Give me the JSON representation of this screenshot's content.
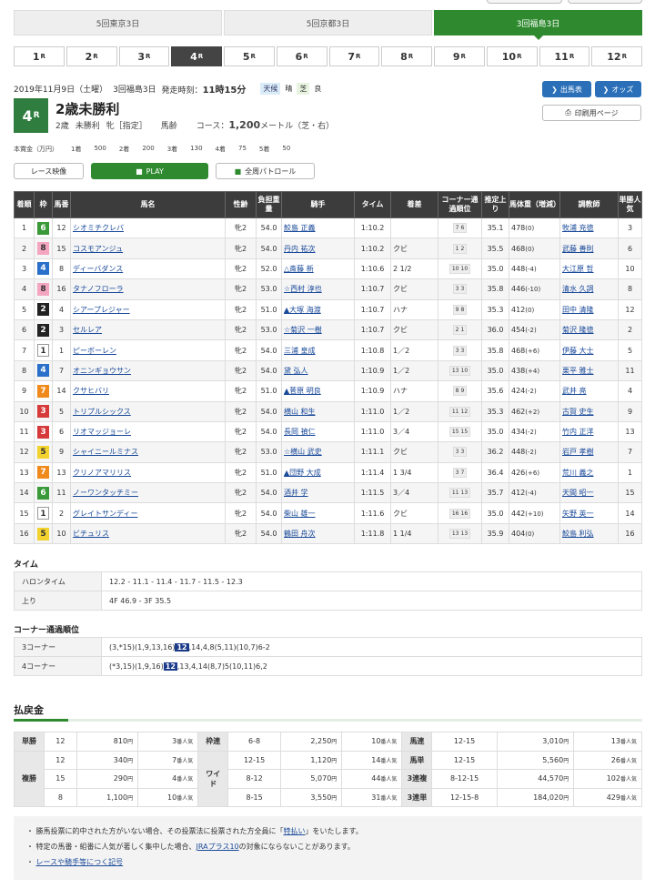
{
  "venues": [
    "5回東京3日",
    "5回京都3日",
    "3回福島3日"
  ],
  "race_numbers": [
    "1",
    "2",
    "3",
    "4",
    "5",
    "6",
    "7",
    "8",
    "9",
    "10",
    "11",
    "12"
  ],
  "race_suffix": "R",
  "header": {
    "date": "2019年11月9日（土曜）",
    "meeting": "3回福島3日",
    "start_label": "発走時刻：",
    "start_time": "11時15分",
    "weather_label": "天候",
    "weather": "晴",
    "track_label": "芝",
    "track": "良"
  },
  "race": {
    "num": "4",
    "name": "2歳未勝利",
    "age": "2歳",
    "cls": "未勝利",
    "sex": "牝［指定］",
    "weight_type": "馬齢",
    "course_label": "コース：",
    "distance": "1,200",
    "course_unit": "メートル（芝・右）"
  },
  "buttons": {
    "entries": "出馬表",
    "odds": "オッズ",
    "print": "印刷用ページ",
    "race_video": "レース映像",
    "play": "PLAY",
    "patrol": "全周パトロール"
  },
  "prize": {
    "label": "本賞金（万円）",
    "items": [
      [
        "1着",
        "500"
      ],
      [
        "2着",
        "200"
      ],
      [
        "3着",
        "130"
      ],
      [
        "4着",
        "75"
      ],
      [
        "5着",
        "50"
      ]
    ]
  },
  "table": {
    "headers": [
      "着順",
      "枠",
      "馬番",
      "馬名",
      "性齢",
      "負担重量",
      "騎手",
      "タイム",
      "着差",
      "コーナー通過順位",
      "推定上り",
      "馬体重（増減）",
      "調教師",
      "単勝人気"
    ],
    "rows": [
      [
        "1",
        "6",
        "12",
        "シオミチクレバ",
        "牝2",
        "54.0",
        "鮫島 正義",
        "1:10.2",
        "",
        "7",
        "6",
        "35.1",
        "478",
        "(0)",
        "牧浦 充徳",
        "3"
      ],
      [
        "2",
        "8",
        "15",
        "コスモアンジュ",
        "牝2",
        "54.0",
        "丹内 祐次",
        "1:10.2",
        "クビ",
        "1",
        "2",
        "35.5",
        "468",
        "(0)",
        "武藤 善則",
        "6"
      ],
      [
        "3",
        "4",
        "8",
        "ディーバダンス",
        "牝2",
        "52.0",
        "△斎藤 新",
        "1:10.6",
        "2 1/2",
        "10",
        "10",
        "35.0",
        "448",
        "(-4)",
        "大江原 哲",
        "10"
      ],
      [
        "4",
        "8",
        "16",
        "タナノフローラ",
        "牝2",
        "53.0",
        "☆西村 淳也",
        "1:10.7",
        "クビ",
        "3",
        "3",
        "35.8",
        "446",
        "(-10)",
        "清水 久詞",
        "8"
      ],
      [
        "5",
        "2",
        "4",
        "シアープレジャー",
        "牝2",
        "51.0",
        "▲大塚 海渡",
        "1:10.7",
        "ハナ",
        "9",
        "8",
        "35.3",
        "412",
        "(0)",
        "田中 清隆",
        "12"
      ],
      [
        "6",
        "2",
        "3",
        "セルレア",
        "牝2",
        "53.0",
        "☆菊沢 一樹",
        "1:10.7",
        "クビ",
        "2",
        "1",
        "36.0",
        "454",
        "(-2)",
        "菊沢 隆徳",
        "2"
      ],
      [
        "7",
        "1",
        "1",
        "ピーボーレン",
        "牝2",
        "54.0",
        "三浦 皇成",
        "1:10.8",
        "1／2",
        "3",
        "3",
        "35.8",
        "468",
        "(+6)",
        "伊藤 大士",
        "5"
      ],
      [
        "8",
        "4",
        "7",
        "オニンギョウサン",
        "牝2",
        "54.0",
        "黛 弘人",
        "1:10.9",
        "1／2",
        "13",
        "10",
        "35.0",
        "438",
        "(+4)",
        "栗平 雅士",
        "11"
      ],
      [
        "9",
        "7",
        "14",
        "クサヒバリ",
        "牝2",
        "51.0",
        "▲菅原 明良",
        "1:10.9",
        "ハナ",
        "8",
        "9",
        "35.6",
        "424",
        "(-2)",
        "武井 亮",
        "4"
      ],
      [
        "10",
        "3",
        "5",
        "トリプルシックス",
        "牝2",
        "54.0",
        "横山 和生",
        "1:11.0",
        "1／2",
        "11",
        "12",
        "35.3",
        "462",
        "(+2)",
        "古賀 史生",
        "9"
      ],
      [
        "11",
        "3",
        "6",
        "リオマッジョーレ",
        "牝2",
        "54.0",
        "長岡 禎仁",
        "1:11.0",
        "3／4",
        "15",
        "15",
        "35.0",
        "434",
        "(-2)",
        "竹内 正洋",
        "13"
      ],
      [
        "12",
        "5",
        "9",
        "シャイニールミナス",
        "牝2",
        "53.0",
        "☆横山 武史",
        "1:11.1",
        "クビ",
        "3",
        "3",
        "36.2",
        "448",
        "(-2)",
        "岩戸 孝樹",
        "7"
      ],
      [
        "13",
        "7",
        "13",
        "クリノアマリリス",
        "牝2",
        "51.0",
        "▲団野 大成",
        "1:11.4",
        "1 3/4",
        "3",
        "7",
        "36.4",
        "426",
        "(+6)",
        "荒川 義之",
        "1"
      ],
      [
        "14",
        "6",
        "11",
        "ノーワンタッチミー",
        "牝2",
        "54.0",
        "酒井 学",
        "1:11.5",
        "3／4",
        "11",
        "13",
        "35.7",
        "412",
        "(-4)",
        "天間 昭一",
        "15"
      ],
      [
        "15",
        "1",
        "2",
        "グレイトサンディー",
        "牝2",
        "54.0",
        "柴山 雄一",
        "1:11.6",
        "クビ",
        "16",
        "16",
        "35.0",
        "442",
        "(+10)",
        "矢野 英一",
        "14"
      ],
      [
        "16",
        "5",
        "10",
        "ビチュリス",
        "牝2",
        "54.0",
        "鶴田 舟次",
        "1:11.8",
        "1 1/4",
        "13",
        "13",
        "35.9",
        "404",
        "(0)",
        "鮫島 利弘",
        "16"
      ]
    ]
  },
  "time": {
    "title": "タイム",
    "lap_label": "ハロンタイム",
    "lap": "12.2 - 11.1 - 11.4 - 11.7 - 11.5 - 12.3",
    "last_label": "上り",
    "last": "4F 46.9 - 3F 35.5"
  },
  "corners": {
    "title": "コーナー通過順位",
    "c3_label": "3コーナー",
    "c3_pre": "(3,*15)(1,9,13,16)",
    "c3_hl": "12",
    "c3_post": ",14,4,8(5,11)(10,7)6-2",
    "c4_label": "4コーナー",
    "c4_pre": "(*3,15)(1,9,16)",
    "c4_hl": "12",
    "c4_post": ",13,4,14(8,7)5(10,11)6,2"
  },
  "payout": {
    "title": "払戻金",
    "yen": "円",
    "pop": "番人気",
    "tansho": {
      "label": "単勝",
      "combo": "12",
      "amount": "810",
      "pop": "3"
    },
    "fukusho": {
      "label": "複勝",
      "rows": [
        [
          "12",
          "340",
          "7"
        ],
        [
          "15",
          "290",
          "4"
        ],
        [
          "8",
          "1,100",
          "10"
        ]
      ]
    },
    "wakuren": {
      "label": "枠連",
      "combo": "6-8",
      "amount": "2,250",
      "pop": "10"
    },
    "wide": {
      "label": "ワイド",
      "rows": [
        [
          "12-15",
          "1,120",
          "14"
        ],
        [
          "8-12",
          "5,070",
          "44"
        ],
        [
          "8-15",
          "3,550",
          "31"
        ]
      ]
    },
    "umaren": {
      "label": "馬連",
      "combo": "12-15",
      "amount": "3,010",
      "pop": "13"
    },
    "umatan": {
      "label": "馬単",
      "combo": "12-15",
      "amount": "5,560",
      "pop": "26"
    },
    "sanrenpuku": {
      "label": "3連複",
      "combo": "8-12-15",
      "amount": "44,570",
      "pop": "102"
    },
    "sanrentan": {
      "label": "3連単",
      "combo": "12-15-8",
      "amount": "184,020",
      "pop": "429"
    }
  },
  "notes": {
    "n1a": "勝馬投票に的中された方がいない場合、その投票法に投票された方全員に「",
    "n1link": "特払い",
    "n1b": "」をいたします。",
    "n2a": "特定の馬番・組番に人気が著しく集中した場合、",
    "n2link": "JRAプラス10",
    "n2b": "の対象にならないことがあります。",
    "n3link": "レースや騎手等につく記号"
  },
  "colors": {
    "waku": {
      "1": [
        "#ffffff",
        "#333"
      ],
      "2": [
        "#222222",
        "#fff"
      ],
      "3": [
        "#d63a3a",
        "#fff"
      ],
      "4": [
        "#2a6fc9",
        "#fff"
      ],
      "5": [
        "#f2d22e",
        "#333"
      ],
      "6": [
        "#3a9a3a",
        "#fff"
      ],
      "7": [
        "#f08a1c",
        "#fff"
      ],
      "8": [
        "#f4a6c0",
        "#333"
      ]
    }
  }
}
